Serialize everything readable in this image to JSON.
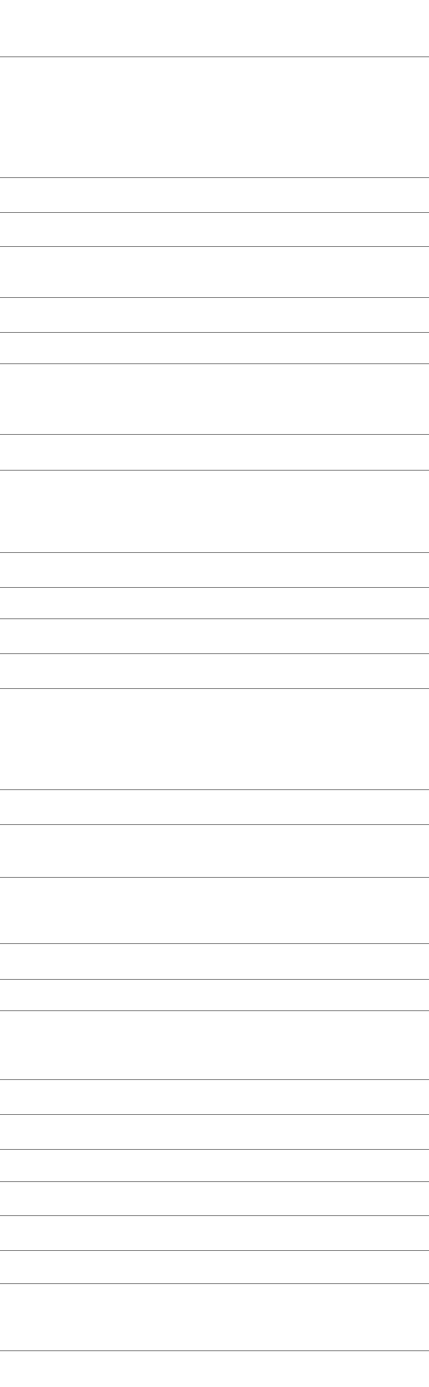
{
  "page": {
    "background_color": "#ffffff",
    "divider_color": "#8a8a8a"
  },
  "list": {
    "row_count": 29,
    "rows": []
  }
}
